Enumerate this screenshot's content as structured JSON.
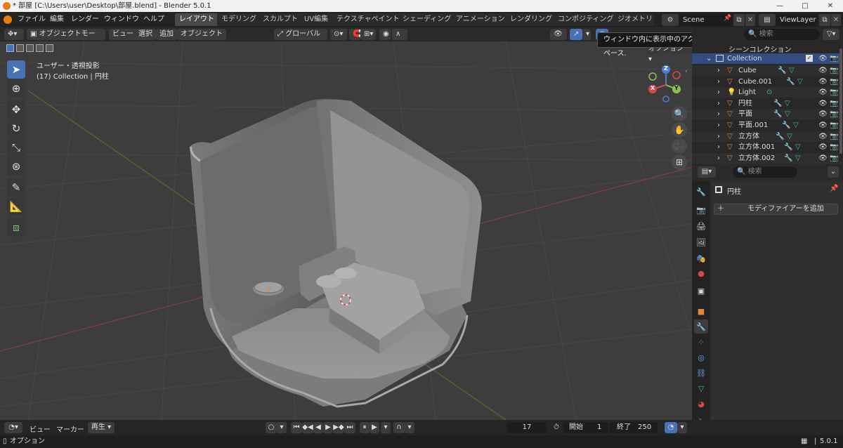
{
  "window": {
    "title": "* 部屋 [C:\\Users\\user\\Desktop\\部屋.blend] - Blender 5.0.1",
    "minimize": "—",
    "maximize": "□",
    "close": "✕"
  },
  "menubar": {
    "menus": [
      "ファイル",
      "編集",
      "レンダー",
      "ウィンドウ",
      "ヘルプ"
    ],
    "workspaces": [
      "レイアウト",
      "モデリング",
      "スカルプト",
      "UV編集",
      "テクスチャペイント",
      "シェーディング",
      "アニメーション",
      "レンダリング",
      "コンポジティング",
      "ジオメトリ"
    ],
    "active_workspace": "レイアウト",
    "scene": "Scene",
    "view_layer": "ViewLayer"
  },
  "viewport_header": {
    "mode": "オブジェクトモード",
    "menus": [
      "ビュー",
      "選択",
      "追加",
      "オブジェクト"
    ],
    "transform_orientation": "グローバル",
    "options": "オプション"
  },
  "viewport": {
    "view_name": "ユーザー・透視投影",
    "collection_info": "(17) Collection | 円柱",
    "gizmo": {
      "x": "X",
      "y": "Y",
      "z": "Z"
    }
  },
  "tooltip": {
    "text": "ウィンドウ内に表示中のアクティブワークスペース."
  },
  "outliner": {
    "search_placeholder": "検索",
    "scene_collection": "シーンコレクション",
    "collection": "Collection",
    "items": [
      {
        "name": "Cube",
        "type": "mesh"
      },
      {
        "name": "Cube.001",
        "type": "mesh"
      },
      {
        "name": "Light",
        "type": "light"
      },
      {
        "name": "円柱",
        "type": "mesh"
      },
      {
        "name": "平面",
        "type": "mesh"
      },
      {
        "name": "平面.001",
        "type": "mesh"
      },
      {
        "name": "立方体",
        "type": "mesh"
      },
      {
        "name": "立方体.001",
        "type": "mesh"
      },
      {
        "name": "立方体.002",
        "type": "mesh"
      }
    ]
  },
  "properties": {
    "search_placeholder": "検索",
    "object_name": "円柱",
    "add_modifier": "モディファイアーを追加"
  },
  "timeline": {
    "menus": [
      "ビュー",
      "マーカー"
    ],
    "playback": "再生",
    "current_frame": "17",
    "start_label": "開始",
    "start": "1",
    "end_label": "終了",
    "end": "250"
  },
  "statusbar": {
    "left_text": "オプション",
    "version": "5.0.1"
  },
  "colors": {
    "accent": "#4772b3",
    "axis_x": "#d44a4a",
    "axis_y": "#8bc34a",
    "axis_z": "#4b7bd4",
    "object_orange": "#e0883a",
    "modifier_blue": "#6aa6e8",
    "mesh_green": "#3fb8a0"
  }
}
